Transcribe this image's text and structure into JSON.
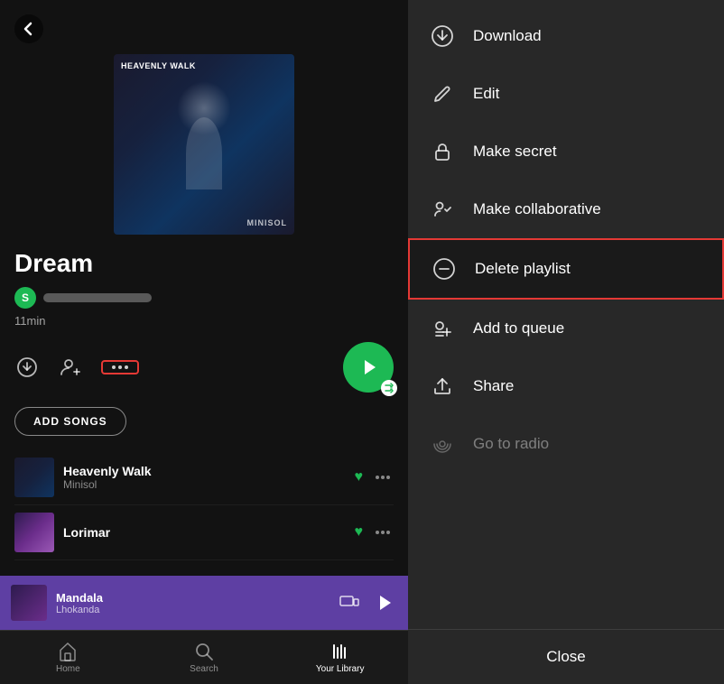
{
  "left": {
    "back_label": "Back",
    "album": {
      "title_top": "HEAVENLY WALK",
      "label_bottom": "MINISOL"
    },
    "playlist_title": "Dream",
    "user_initial": "S",
    "duration": "11min",
    "controls": {
      "download_title": "Download",
      "add_follower_title": "Add follower",
      "more_title": "More options"
    },
    "add_songs_label": "ADD SONGS",
    "tracks": [
      {
        "name": "Heavenly Walk",
        "artist": "Minisol",
        "liked": true
      },
      {
        "name": "Lorimar",
        "artist": "",
        "liked": true
      }
    ]
  },
  "now_playing": {
    "title": "Mandala",
    "artist": "Lhokanda"
  },
  "bottom_nav": {
    "items": [
      {
        "label": "Home",
        "active": false
      },
      {
        "label": "Search",
        "active": false
      },
      {
        "label": "Your Library",
        "active": true
      }
    ]
  },
  "menu": {
    "items": [
      {
        "id": "download",
        "label": "Download",
        "highlighted": false,
        "dimmed": false
      },
      {
        "id": "edit",
        "label": "Edit",
        "highlighted": false,
        "dimmed": false
      },
      {
        "id": "make-secret",
        "label": "Make secret",
        "highlighted": false,
        "dimmed": false
      },
      {
        "id": "make-collaborative",
        "label": "Make collaborative",
        "highlighted": false,
        "dimmed": false
      },
      {
        "id": "delete-playlist",
        "label": "Delete playlist",
        "highlighted": true,
        "dimmed": false
      },
      {
        "id": "add-to-queue",
        "label": "Add to queue",
        "highlighted": false,
        "dimmed": false
      },
      {
        "id": "share",
        "label": "Share",
        "highlighted": false,
        "dimmed": false
      },
      {
        "id": "go-to-radio",
        "label": "Go to radio",
        "highlighted": false,
        "dimmed": true
      }
    ],
    "close_label": "Close"
  }
}
